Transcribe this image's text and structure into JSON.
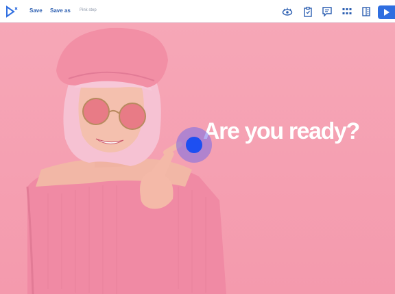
{
  "toolbar": {
    "save_label": "Save",
    "save_as_label": "Save as",
    "step_title": "Pink step",
    "icons": [
      "preview-eye-icon",
      "clipboard-icon",
      "comment-icon",
      "grid-icon",
      "panel-icon",
      "play-icon"
    ],
    "accent": "#2f6ee0"
  },
  "canvas": {
    "headline": "Are you ready?",
    "background": "#f6a3b4",
    "hotspot_color": "#1d4ff2"
  }
}
